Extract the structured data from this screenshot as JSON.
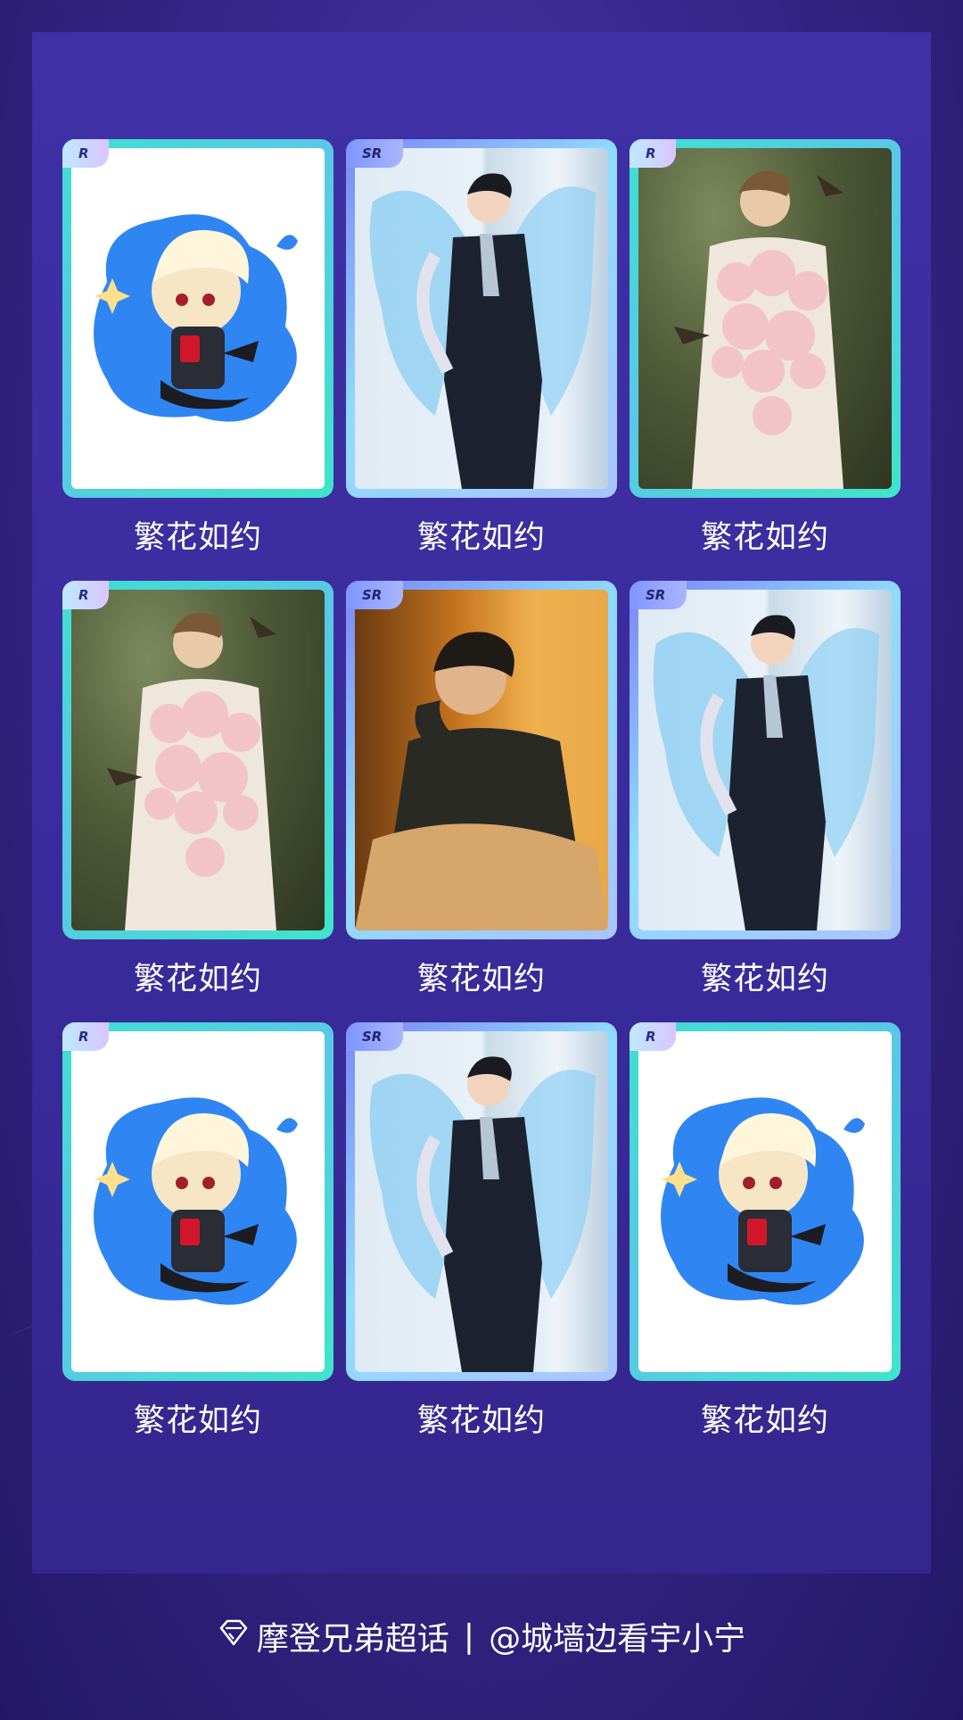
{
  "cards": [
    {
      "rarity": "R",
      "caption": "繁花如约",
      "art": "chibi-vampire"
    },
    {
      "rarity": "SR",
      "caption": "繁花如约",
      "art": "butterfly-wing-suit"
    },
    {
      "rarity": "R",
      "caption": "繁花如约",
      "art": "flower-bouquet-portrait"
    },
    {
      "rarity": "R",
      "caption": "繁花如约",
      "art": "flower-bouquet-portrait"
    },
    {
      "rarity": "SR",
      "caption": "繁花如约",
      "art": "sweater-portrait"
    },
    {
      "rarity": "SR",
      "caption": "繁花如约",
      "art": "butterfly-wing-suit"
    },
    {
      "rarity": "R",
      "caption": "繁花如约",
      "art": "chibi-vampire"
    },
    {
      "rarity": "SR",
      "caption": "繁花如约",
      "art": "butterfly-wing-suit"
    },
    {
      "rarity": "R",
      "caption": "繁花如约",
      "art": "chibi-vampire"
    }
  ],
  "footer": {
    "icon": "diamond-icon",
    "topic": "摩登兄弟超话",
    "separator": "|",
    "author": "@城墙边看宇小宁"
  },
  "colors": {
    "background": "#2a1d6e",
    "panel": "#3a2b9c",
    "frame_r": "#3ee0d0",
    "frame_sr": "#8fdcff",
    "text": "#ffffff"
  }
}
